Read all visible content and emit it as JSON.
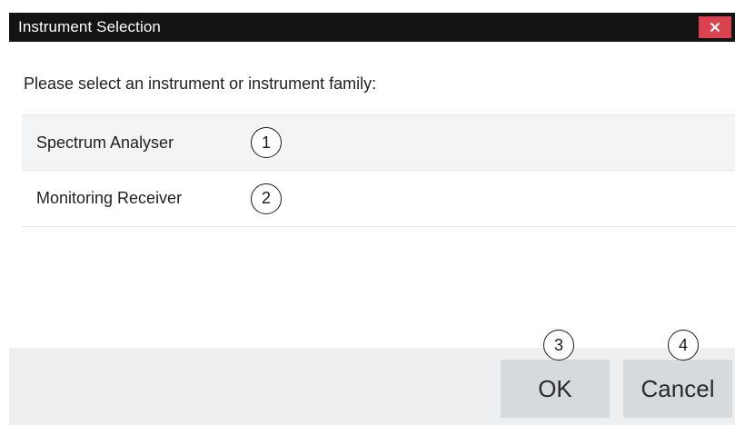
{
  "window": {
    "title": "Instrument Selection",
    "close_icon": "close-icon"
  },
  "prompt": "Please select an instrument or instrument family:",
  "instruments": [
    {
      "label": "Spectrum Analyser",
      "callout": "1",
      "selected": true
    },
    {
      "label": "Monitoring Receiver",
      "callout": "2",
      "selected": false
    }
  ],
  "buttons": {
    "ok_label": "OK",
    "ok_callout": "3",
    "cancel_label": "Cancel",
    "cancel_callout": "4"
  },
  "colors": {
    "titlebar": "#141414",
    "close_button": "#d9434d",
    "footer": "#edeff1",
    "button": "#d7dadd",
    "selected_row": "#f3f4f6"
  }
}
